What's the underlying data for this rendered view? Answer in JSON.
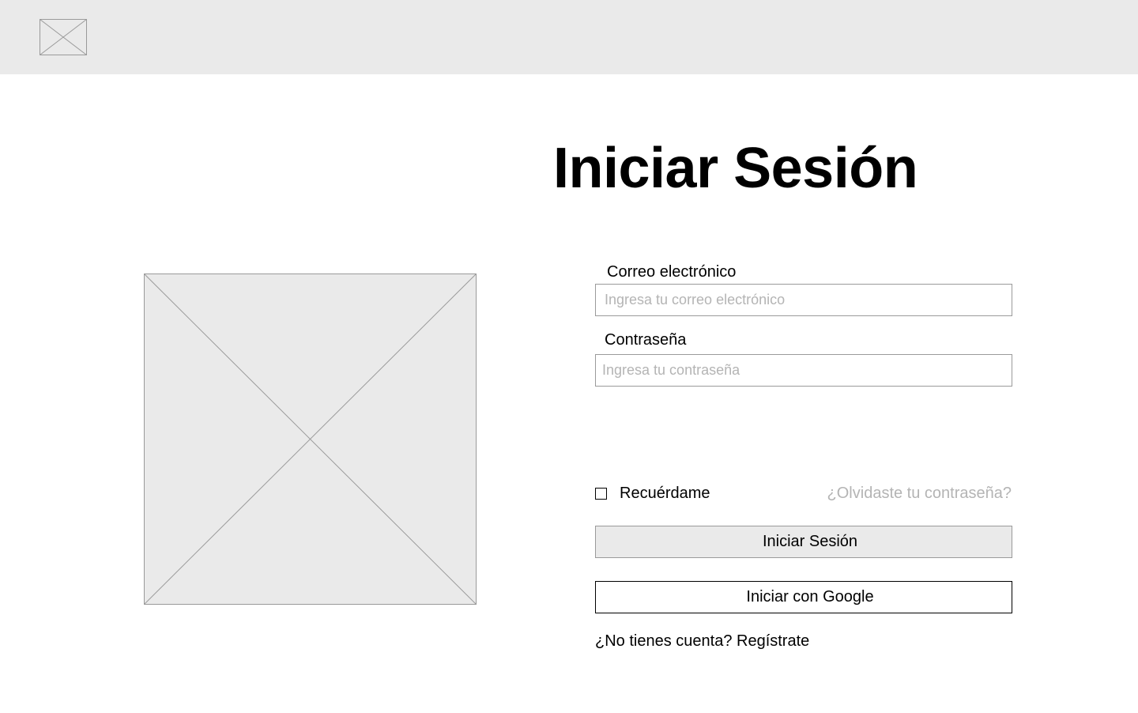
{
  "header": {
    "logo_icon": "image-placeholder-icon"
  },
  "hero": {
    "image_icon": "image-placeholder-icon"
  },
  "login": {
    "title": "Iniciar Sesión",
    "email_label": "Correo electrónico",
    "email_placeholder": "Ingresa tu correo electrónico",
    "email_value": "",
    "password_label": "Contraseña",
    "password_placeholder": "Ingresa tu contraseña",
    "password_value": "",
    "remember_label": "Recuérdame",
    "remember_checked": false,
    "forgot_label": "¿Olvidaste tu contraseña?",
    "submit_label": "Iniciar Sesión",
    "google_label": "Iniciar con Google",
    "signup_prompt": "¿No tienes cuenta?",
    "signup_link": "Regístrate"
  },
  "colors": {
    "topbar_bg": "#eaeaea",
    "placeholder_fill": "#eaeaea",
    "placeholder_text": "#b4b4b4",
    "border_gray": "#9a9a9a",
    "text": "#000000"
  }
}
